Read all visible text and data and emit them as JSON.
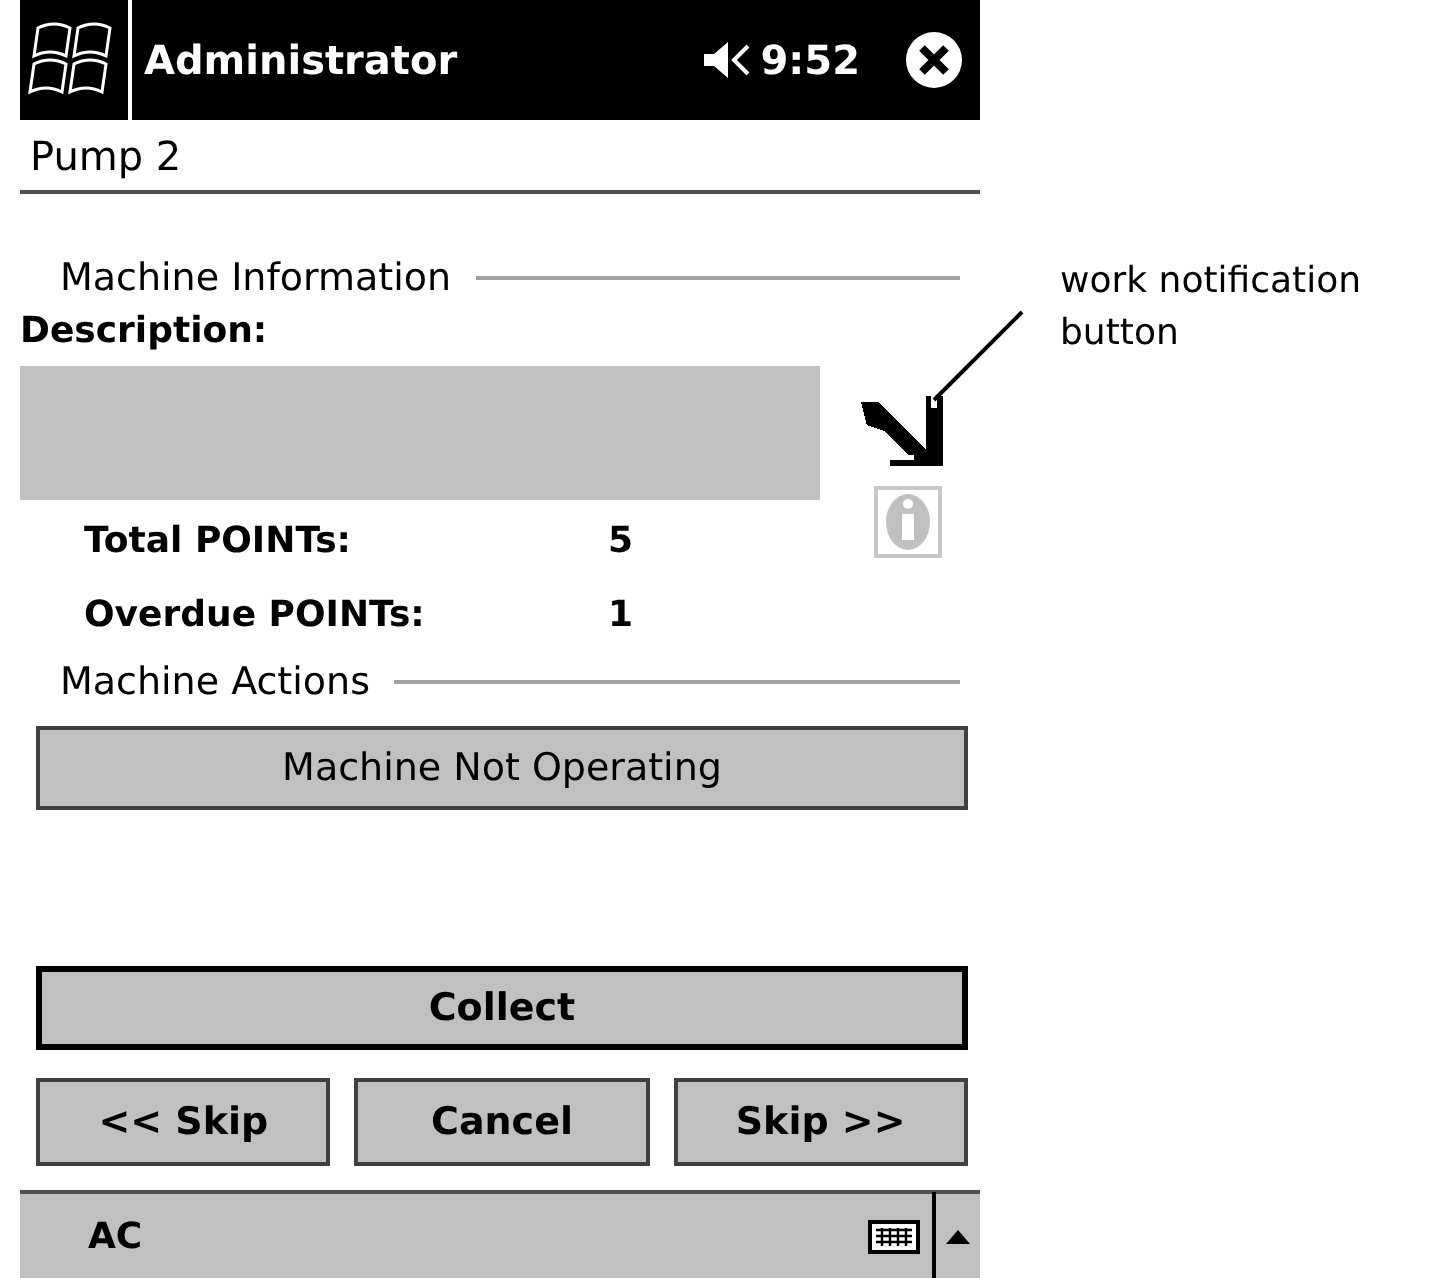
{
  "title_bar": {
    "title": "Administrator",
    "time": "9:52"
  },
  "header": {
    "title": "Pump 2"
  },
  "machine_information": {
    "heading": "Machine Information",
    "description_label": "Description:",
    "stats": [
      {
        "label": "Total POINTs:",
        "value": "5"
      },
      {
        "label": "Overdue POINTs:",
        "value": "1"
      }
    ],
    "info_button": {
      "disabled": true
    }
  },
  "machine_actions": {
    "heading": "Machine Actions",
    "button": "Machine Not Operating"
  },
  "collect_button": {
    "label": "Collect",
    "default": true
  },
  "nav_buttons": [
    "<< Skip",
    "Cancel",
    "Skip >>"
  ],
  "bottom_bar": {
    "label": "AC"
  },
  "annotation": {
    "text": "work notification button"
  }
}
